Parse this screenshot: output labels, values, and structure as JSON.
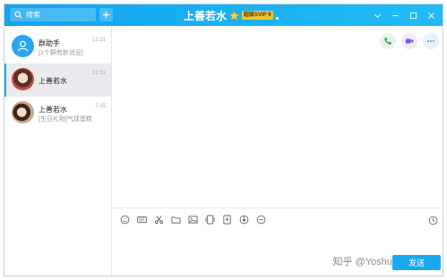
{
  "titlebar": {
    "search_placeholder": "搜索",
    "contact_name": "上善若水",
    "vip_badge": "超级SVIP 9",
    "accent_color": "#19b3f5"
  },
  "conversations": [
    {
      "name": "群助手",
      "preview": "[1个群有新消息]",
      "time": "12:31",
      "avatar": "group-helper-icon"
    },
    {
      "name": "上善若水",
      "preview": "",
      "time": "12:31",
      "avatar": "avatar-girl",
      "active": true
    },
    {
      "name": "上善若水",
      "preview": "[生日礼物]气球蛋糕",
      "time": "7-15",
      "avatar": "avatar-girl-2"
    }
  ],
  "main": {
    "send_label": "发送",
    "watermark": "知乎 @Yoshua",
    "toolbar_icons": [
      "emoji-icon",
      "gif-icon",
      "scissors-icon",
      "folder-icon",
      "image-icon",
      "screen-record-icon",
      "file-transfer-icon",
      "red-packet-icon",
      "more-circle-icon"
    ]
  }
}
